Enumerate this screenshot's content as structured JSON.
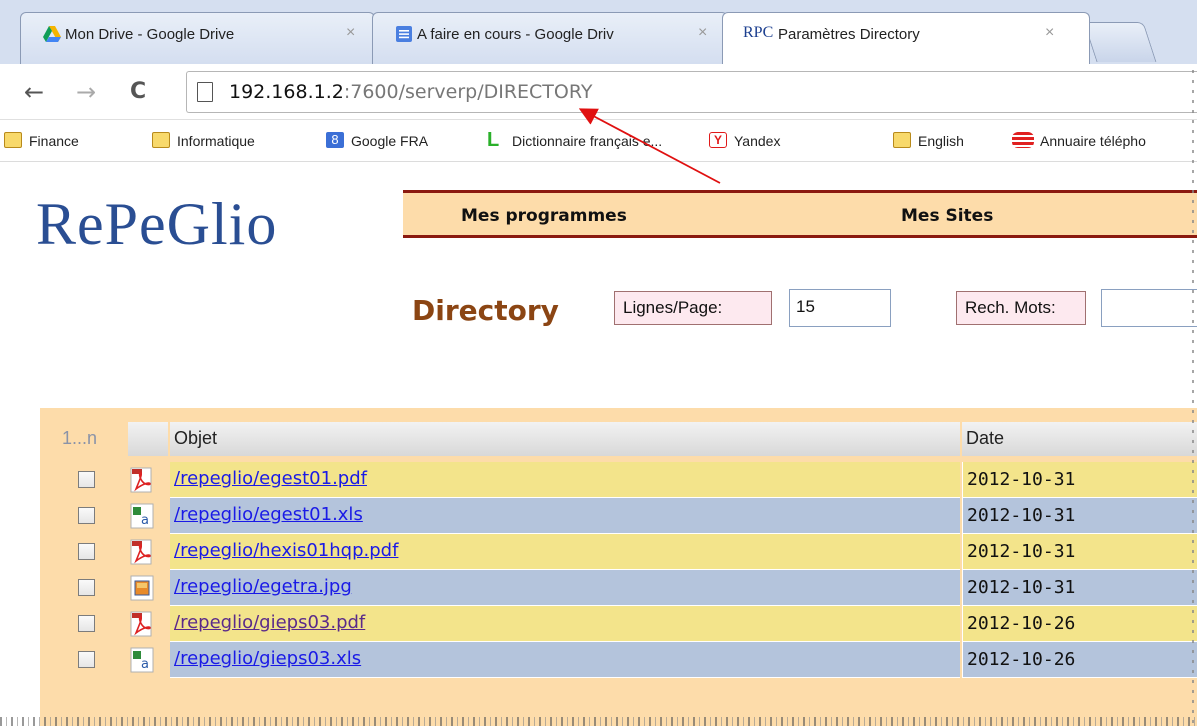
{
  "browser": {
    "tabs": [
      {
        "title": "Mon Drive - Google Drive",
        "icon": "google-drive-icon",
        "close": "×"
      },
      {
        "title": "A faire en cours - Google Driv",
        "icon": "google-docs-icon",
        "close": "×"
      },
      {
        "title": "Paramètres Directory",
        "icon": "rpc-favicon-icon",
        "icon_text": "RPC",
        "close": "×",
        "active": true
      }
    ],
    "nav": {
      "back": "←",
      "forward": "→",
      "reload": "C"
    },
    "url": {
      "host": "192.168.1.2",
      "rest": ":7600/serverp/DIRECTORY"
    },
    "bookmarks": [
      {
        "label": "Finance",
        "icon": "folder-icon"
      },
      {
        "label": "Informatique",
        "icon": "folder-icon"
      },
      {
        "label": "Google FRA",
        "icon": "google-icon",
        "icon_text": "8"
      },
      {
        "label": "Dictionnaire français e...",
        "icon": "larousse-icon",
        "icon_text": "L"
      },
      {
        "label": "Yandex",
        "icon": "yandex-icon",
        "icon_text": "Y"
      },
      {
        "label": "English",
        "icon": "folder-icon"
      },
      {
        "label": "Annuaire télépho",
        "icon": "phonebook-icon"
      }
    ]
  },
  "page": {
    "logo": "RePeGlio",
    "menu": [
      "Mes programmes",
      "Mes Sites"
    ],
    "title": "Directory",
    "lines_label": "Lignes/Page:",
    "lines_value": "15",
    "search_label": "Rech. Mots:",
    "search_value": ""
  },
  "table": {
    "headers": {
      "n": "1...n",
      "object": "Objet",
      "date": "Date"
    },
    "rows": [
      {
        "object": "/repeglio/egest01.pdf",
        "date": "2012-10-31",
        "type": "pdf",
        "color": "yellow"
      },
      {
        "object": "/repeglio/egest01.xls",
        "date": "2012-10-31",
        "type": "xls",
        "color": "blue"
      },
      {
        "object": "/repeglio/hexis01hqp.pdf",
        "date": "2012-10-31",
        "type": "pdf",
        "color": "yellow"
      },
      {
        "object": "/repeglio/egetra.jpg",
        "date": "2012-10-31",
        "type": "jpg",
        "color": "blue"
      },
      {
        "object": "/repeglio/gieps03.pdf",
        "date": "2012-10-26",
        "type": "pdf",
        "color": "yellow"
      },
      {
        "object": "/repeglio/gieps03.xls",
        "date": "2012-10-26",
        "type": "xls",
        "color": "blue"
      }
    ]
  },
  "colors": {
    "menu_bg": "#fddcaa",
    "menu_border": "#8b1a10",
    "logo": "#2a4e93",
    "title": "#8b4513",
    "row_yellow": "#f3e48b",
    "row_blue": "#b4c4dc",
    "link": "#1a1ae6",
    "annotation_arrow": "#e01010"
  }
}
